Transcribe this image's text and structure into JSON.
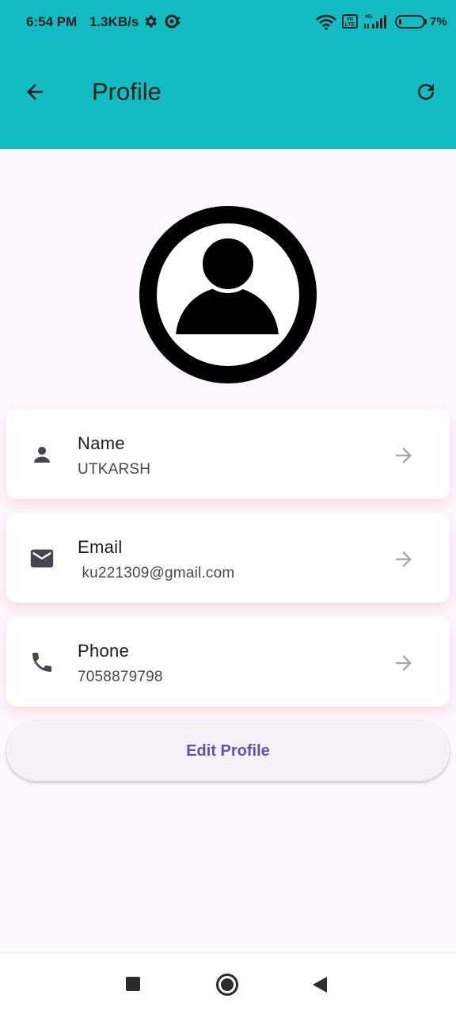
{
  "status_bar": {
    "time": "6:54 PM",
    "net_speed": "1.3KB/s",
    "volte": "Vo LTE",
    "network": "4G",
    "battery": "7%"
  },
  "app_bar": {
    "title": "Profile",
    "background": "#12bcc3",
    "back_icon": "arrow-back-icon",
    "refresh_icon": "refresh-icon"
  },
  "profile": {
    "fields": [
      {
        "label": "Name",
        "value": "UTKARSH",
        "icon": "person-icon"
      },
      {
        "label": "Email",
        "value": " ku221309@gmail.com",
        "icon": "mail-icon"
      },
      {
        "label": "Phone",
        "value": "7058879798",
        "icon": "phone-icon"
      }
    ]
  },
  "actions": {
    "edit_profile_label": "Edit Profile",
    "accent": "#6750a4"
  }
}
